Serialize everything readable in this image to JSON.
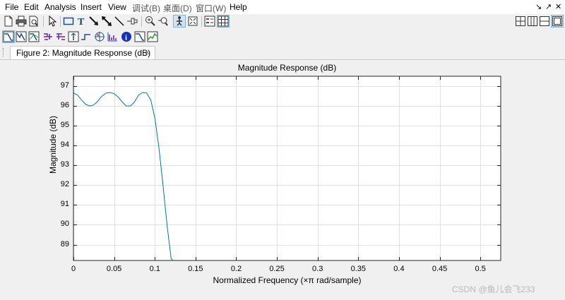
{
  "menubar": {
    "items": [
      "File",
      "Edit",
      "Analysis",
      "Insert",
      "View",
      "调试(B)",
      "桌面(D)",
      "窗口(W)",
      "Help"
    ],
    "dock_arrows": [
      "↘",
      "↗",
      "✕"
    ]
  },
  "toolbar1": {
    "icons": [
      "new-file-icon",
      "print-icon",
      "print-preview-icon",
      "pointer-icon",
      "rectangle-icon",
      "text-icon",
      "arrow-icon",
      "double-arrow-icon",
      "line-icon",
      "pin-icon",
      "zoom-in-icon",
      "zoom-out-icon",
      "pan-icon",
      "zoom-fit-icon",
      "legend-icon",
      "grid-icon"
    ],
    "layout_icons": [
      "tile-layout-icon",
      "left-right-layout-icon",
      "top-bottom-layout-icon",
      "float-layout-icon"
    ]
  },
  "toolbar2": {
    "icons": [
      "magnitude-response-icon",
      "phase-response-icon",
      "magnitude-phase-icon",
      "group-delay-icon",
      "phase-delay-icon",
      "impulse-response-icon",
      "step-response-icon",
      "pole-zero-icon",
      "filter-coefficients-icon",
      "filter-info-icon",
      "magnitude-estimate-icon",
      "round-off-noise-icon"
    ]
  },
  "tab": {
    "label": "Figure 2: Magnitude Response (dB)",
    "close": "✕"
  },
  "watermark": "CSDN @鱼儿会飞233",
  "chart_data": {
    "type": "line",
    "title": "Magnitude Response (dB)",
    "xlabel": "Normalized Frequency (×π rad/sample)",
    "ylabel": "Magnitude (dB)",
    "xlim": [
      0,
      0.525
    ],
    "ylim": [
      88.2,
      97.5
    ],
    "xticks": [
      0,
      0.05,
      0.1,
      0.15,
      0.2,
      0.25,
      0.3,
      0.35,
      0.4,
      0.45,
      0.5
    ],
    "xtick_labels": [
      "0",
      "0.05",
      "0.1",
      "0.15",
      "0.2",
      "0.25",
      "0.3",
      "0.35",
      "0.4",
      "0.45",
      "0.5"
    ],
    "yticks": [
      89,
      90,
      91,
      92,
      93,
      94,
      95,
      96,
      97
    ],
    "ytick_labels": [
      "89",
      "90",
      "91",
      "92",
      "93",
      "94",
      "95",
      "96",
      "97"
    ],
    "grid": true,
    "line_color": "#0072bd",
    "series": [
      {
        "x": [
          0,
          0.005,
          0.01,
          0.015,
          0.02,
          0.025,
          0.03,
          0.035,
          0.04,
          0.045,
          0.05,
          0.055,
          0.06,
          0.065,
          0.07,
          0.075,
          0.08,
          0.085,
          0.09,
          0.095,
          0.1,
          0.105,
          0.11,
          0.115,
          0.12,
          0.122
        ],
        "y": [
          96.66,
          96.55,
          96.3,
          96.08,
          96.0,
          96.05,
          96.25,
          96.5,
          96.65,
          96.68,
          96.62,
          96.45,
          96.2,
          96.0,
          96.0,
          96.2,
          96.55,
          96.68,
          96.65,
          96.3,
          95.4,
          93.9,
          92.0,
          90.0,
          88.3,
          88.2
        ]
      }
    ]
  }
}
